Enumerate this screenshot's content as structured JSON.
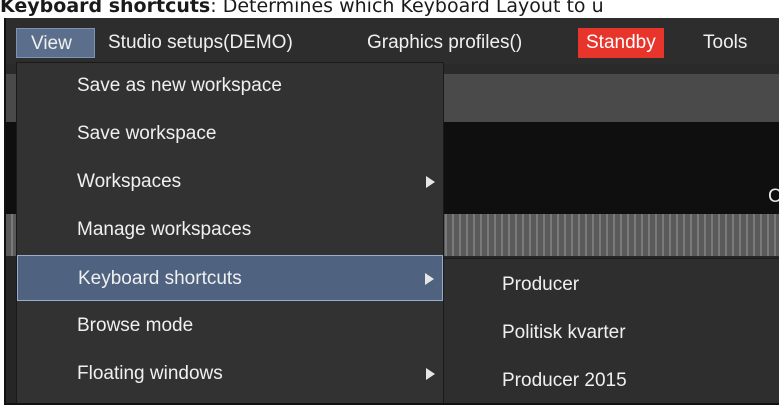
{
  "caption": {
    "bold": "Keyboard shortcuts",
    "rest": ": Determines which Keyboard Layout to u"
  },
  "menubar": {
    "items": [
      {
        "label": "View"
      },
      {
        "label": "Studio setups(DEMO)"
      },
      {
        "label": "Graphics profiles()"
      },
      {
        "label": "Standby"
      },
      {
        "label": "Tools"
      }
    ]
  },
  "dropdown": {
    "items": [
      {
        "label": "Save as new workspace",
        "has_submenu": false
      },
      {
        "label": "Save workspace",
        "has_submenu": false
      },
      {
        "label": "Workspaces",
        "has_submenu": true
      },
      {
        "label": "Manage workspaces",
        "has_submenu": false
      },
      {
        "label": "Keyboard shortcuts",
        "has_submenu": true
      },
      {
        "label": "Browse mode",
        "has_submenu": false
      },
      {
        "label": "Floating windows",
        "has_submenu": true
      }
    ]
  },
  "submenu": {
    "items": [
      {
        "label": "Producer"
      },
      {
        "label": "Politisk kvarter"
      },
      {
        "label": "Producer 2015"
      }
    ]
  },
  "background": {
    "cut_text": "C"
  },
  "colors": {
    "accent": "#5b6f8c",
    "standby": "#e8352c",
    "menu_bg": "#323232"
  }
}
